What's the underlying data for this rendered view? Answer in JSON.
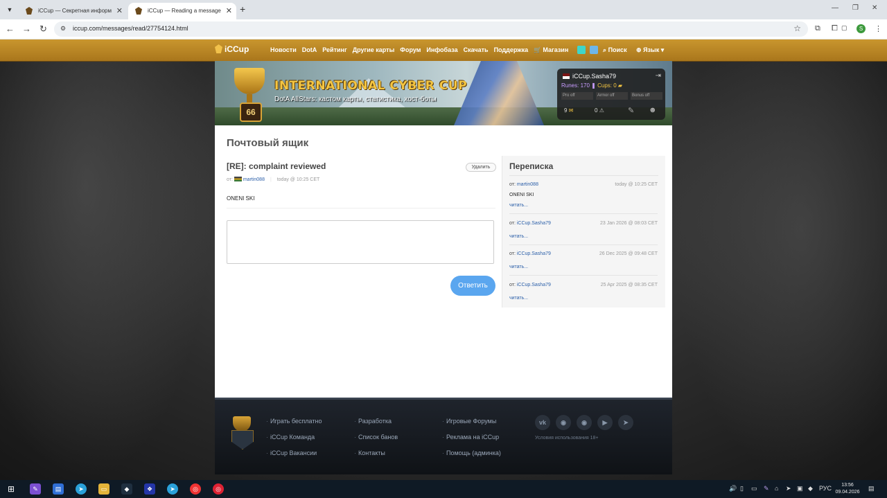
{
  "browser": {
    "tabs": [
      {
        "title": "iCCup — Секретная информация"
      },
      {
        "title": "iCCup — Reading a message from"
      }
    ],
    "url": "iccup.com/messages/read/27754124.html",
    "profile_initial": "S"
  },
  "site": {
    "logo": "iCCup",
    "menu": [
      "Новости",
      "DotA",
      "Рейтинг",
      "Другие карты",
      "Форум",
      "Инфобаза",
      "Скачать",
      "Поддержка",
      "Магазин"
    ],
    "search": "Поиск",
    "language": "Язык",
    "banner": {
      "level": "66",
      "title": "INTERNATIONAL CYBER CUP",
      "subtitle": "DotA AllStars: кастом карты, статистика, хост-боты"
    },
    "user": {
      "name": "iCCup.Sasha79",
      "runes_label": "Runes: 170",
      "cups_label": "Cups: 0",
      "stats": [
        "Pro off",
        "Armor off",
        "Bonus off"
      ],
      "mail_count": "9",
      "warn_count": "0"
    }
  },
  "mailbox": {
    "title": "Почтовый ящик",
    "subject": "[RE]: complaint reviewed",
    "delete_label": "Удалить",
    "from_label": "от:",
    "author": "martin088",
    "time": "today @ 10:25 CET",
    "body": "ONENI SKI",
    "reply_label": "Ответить"
  },
  "correspondence": {
    "title": "Переписка",
    "read_label": "читать...",
    "items": [
      {
        "from": "от:",
        "who": "martin088",
        "time": "today @ 10:25 CET",
        "snippet": "ONENI SKI"
      },
      {
        "from": "от:",
        "who": "iCCup.Sasha79",
        "time": "23 Jan 2026 @ 08:03 CET",
        "snippet": ""
      },
      {
        "from": "от:",
        "who": "iCCup.Sasha79",
        "time": "26 Dec 2025 @ 09:48 CET",
        "snippet": ""
      },
      {
        "from": "от:",
        "who": "iCCup.Sasha79",
        "time": "25 Apr 2025 @ 08:35 CET",
        "snippet": ""
      }
    ]
  },
  "footer": {
    "col1": [
      "Играть бесплатно",
      "iCCup Команда",
      "iCCup Вакансии"
    ],
    "col2": [
      "Разработка",
      "Список банов",
      "Контакты"
    ],
    "col3": [
      "Игровые Форумы",
      "Реклама на iCCup",
      "Помощь (админка)"
    ],
    "terms": "Условия использования 18+"
  },
  "taskbar": {
    "lang": "РУС",
    "time": "13:56",
    "date": "09.04.2026"
  }
}
